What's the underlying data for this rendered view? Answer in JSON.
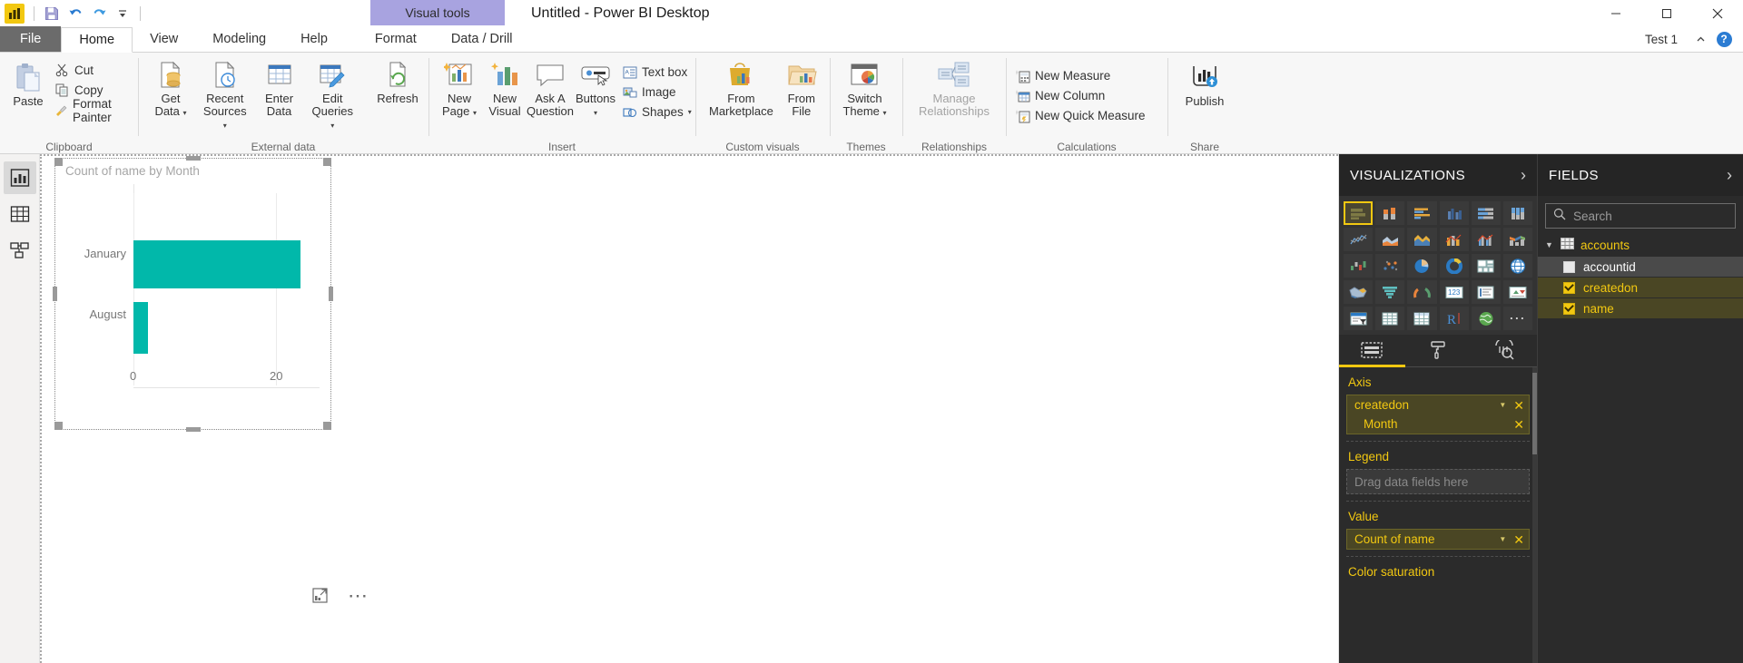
{
  "titlebar": {
    "app_logo": "powerbi-logo-icon",
    "quick_access": [
      {
        "name": "save-icon",
        "label": "Save"
      },
      {
        "name": "undo-icon",
        "label": "Undo"
      },
      {
        "name": "redo-icon",
        "label": "Redo"
      },
      {
        "name": "customize-qat-icon",
        "label": "Customize Quick Access Toolbar"
      }
    ],
    "contextual_tab_group": "Visual tools",
    "window_title": "Untitled - Power BI Desktop",
    "window_controls": [
      "minimize",
      "maximize",
      "close"
    ]
  },
  "tabs": {
    "file": "File",
    "items": [
      {
        "label": "Home",
        "active": true
      },
      {
        "label": "View",
        "active": false
      },
      {
        "label": "Modeling",
        "active": false
      },
      {
        "label": "Help",
        "active": false
      }
    ],
    "contextual": [
      {
        "label": "Format"
      },
      {
        "label": "Data / Drill"
      }
    ],
    "user": "Test 1",
    "collapse_ribbon": "chevron-up-icon",
    "help": "?"
  },
  "ribbon": {
    "groups": [
      {
        "label": "Clipboard",
        "big": [
          {
            "name": "paste-button",
            "label": "Paste"
          }
        ],
        "small": [
          {
            "name": "cut-button",
            "label": "Cut",
            "icon": "scissors-icon"
          },
          {
            "name": "copy-button",
            "label": "Copy",
            "icon": "copy-icon"
          },
          {
            "name": "format-painter-button",
            "label": "Format Painter",
            "icon": "paintbrush-icon"
          }
        ]
      },
      {
        "label": "External data",
        "big": [
          {
            "name": "get-data-button",
            "label": "Get\nData",
            "dropdown": true
          },
          {
            "name": "recent-sources-button",
            "label": "Recent\nSources",
            "dropdown": true
          },
          {
            "name": "enter-data-button",
            "label": "Enter\nData",
            "dropdown": false
          },
          {
            "name": "edit-queries-button",
            "label": "Edit\nQueries",
            "dropdown": true
          },
          {
            "name": "refresh-button",
            "label": "Refresh",
            "dropdown": false
          }
        ]
      },
      {
        "label": "Insert",
        "big": [
          {
            "name": "new-page-button",
            "label": "New\nPage",
            "dropdown": true
          },
          {
            "name": "new-visual-button",
            "label": "New\nVisual",
            "dropdown": false
          },
          {
            "name": "ask-a-question-button",
            "label": "Ask A\nQuestion",
            "dropdown": false
          },
          {
            "name": "buttons-button",
            "label": "Buttons",
            "dropdown": true
          }
        ],
        "small": [
          {
            "name": "text-box-button",
            "label": "Text box",
            "icon": "text-box-icon"
          },
          {
            "name": "image-button",
            "label": "Image",
            "icon": "image-icon"
          },
          {
            "name": "shapes-button",
            "label": "Shapes",
            "icon": "shapes-icon",
            "dropdown": true
          }
        ]
      },
      {
        "label": "Custom visuals",
        "big": [
          {
            "name": "from-marketplace-button",
            "label": "From\nMarketplace",
            "dropdown": false
          },
          {
            "name": "from-file-button",
            "label": "From\nFile",
            "dropdown": false
          }
        ]
      },
      {
        "label": "Themes",
        "big": [
          {
            "name": "switch-theme-button",
            "label": "Switch\nTheme",
            "dropdown": true
          }
        ]
      },
      {
        "label": "Relationships",
        "big": [
          {
            "name": "manage-relationships-button",
            "label": "Manage\nRelationships",
            "disabled": true
          }
        ]
      },
      {
        "label": "Calculations",
        "small": [
          {
            "name": "new-measure-button",
            "label": "New Measure",
            "icon": "new-measure-icon"
          },
          {
            "name": "new-column-button",
            "label": "New Column",
            "icon": "new-column-icon"
          },
          {
            "name": "new-quick-measure-button",
            "label": "New Quick Measure",
            "icon": "new-quick-measure-icon"
          }
        ]
      },
      {
        "label": "Share",
        "big": [
          {
            "name": "publish-button",
            "label": "Publish"
          }
        ]
      }
    ]
  },
  "leftnav": [
    {
      "name": "report-view-icon",
      "label": "Report",
      "active": true
    },
    {
      "name": "data-view-icon",
      "label": "Data",
      "active": false
    },
    {
      "name": "model-view-icon",
      "label": "Model",
      "active": false
    }
  ],
  "visual": {
    "title": "Count of name by Month",
    "footer_buttons": [
      {
        "name": "focus-mode-icon",
        "label": "Focus mode"
      },
      {
        "name": "more-options-icon",
        "label": "More options"
      }
    ]
  },
  "chart_data": {
    "type": "bar",
    "orientation": "horizontal",
    "title": "Count of name by Month",
    "categories": [
      "January",
      "August"
    ],
    "values": [
      22,
      2
    ],
    "series": [
      {
        "name": "Count of name",
        "values": [
          22,
          2
        ]
      }
    ],
    "xlabel": "",
    "ylabel": "",
    "xticks": [
      "0",
      "20"
    ],
    "xtick_values": [
      0,
      20
    ],
    "xlim": [
      0,
      24
    ],
    "grid": true,
    "legend": "none",
    "bar_color": "#01b8aa"
  },
  "visualizations": {
    "header": "VISUALIZATIONS",
    "expand_icon": "chevron-right-icon",
    "gallery": [
      {
        "name": "stacked-bar-chart-icon",
        "selected": true
      },
      {
        "name": "stacked-column-chart-icon",
        "selected": false
      },
      {
        "name": "clustered-bar-chart-icon",
        "selected": false
      },
      {
        "name": "clustered-column-chart-icon",
        "selected": false
      },
      {
        "name": "100-stacked-bar-chart-icon",
        "selected": false
      },
      {
        "name": "100-stacked-column-chart-icon",
        "selected": false
      },
      {
        "name": "line-chart-icon",
        "selected": false
      },
      {
        "name": "area-chart-icon",
        "selected": false
      },
      {
        "name": "stacked-area-chart-icon",
        "selected": false
      },
      {
        "name": "line-stacked-column-chart-icon",
        "selected": false
      },
      {
        "name": "line-clustered-column-chart-icon",
        "selected": false
      },
      {
        "name": "ribbon-chart-icon",
        "selected": false
      },
      {
        "name": "waterfall-chart-icon",
        "selected": false
      },
      {
        "name": "scatter-chart-icon",
        "selected": false
      },
      {
        "name": "pie-chart-icon",
        "selected": false
      },
      {
        "name": "donut-chart-icon",
        "selected": false
      },
      {
        "name": "treemap-icon",
        "selected": false
      },
      {
        "name": "map-icon",
        "selected": false
      },
      {
        "name": "filled-map-icon",
        "selected": false
      },
      {
        "name": "funnel-icon",
        "selected": false
      },
      {
        "name": "gauge-icon",
        "selected": false
      },
      {
        "name": "card-icon",
        "selected": false
      },
      {
        "name": "multi-row-card-icon",
        "selected": false
      },
      {
        "name": "kpi-icon",
        "selected": false
      },
      {
        "name": "slicer-icon",
        "selected": false
      },
      {
        "name": "table-icon",
        "selected": false
      },
      {
        "name": "matrix-icon",
        "selected": false
      },
      {
        "name": "r-script-visual-icon",
        "selected": false
      },
      {
        "name": "arcgis-map-icon",
        "selected": false
      },
      {
        "name": "more-visuals-icon",
        "selected": false
      }
    ],
    "subtabs": [
      {
        "name": "fields-tab",
        "icon": "fields-pane-icon",
        "active": true
      },
      {
        "name": "format-tab",
        "icon": "paint-roller-icon",
        "active": false
      },
      {
        "name": "analytics-tab",
        "icon": "magnifier-chart-icon",
        "active": false
      }
    ],
    "wells": [
      {
        "label": "Axis",
        "chips": [
          {
            "text": "createdon",
            "has_caret": true,
            "has_remove": true,
            "sub": {
              "text": "Month",
              "has_remove": true
            }
          }
        ],
        "placeholder": null
      },
      {
        "label": "Legend",
        "chips": [],
        "placeholder": "Drag data fields here"
      },
      {
        "label": "Value",
        "chips": [
          {
            "text": "Count of name",
            "has_caret": true,
            "has_remove": true
          }
        ],
        "placeholder": null
      },
      {
        "label": "Color saturation",
        "chips": [],
        "placeholder": null
      }
    ]
  },
  "fields": {
    "header": "FIELDS",
    "expand_icon": "chevron-right-icon",
    "search_placeholder": "Search",
    "search_value": "",
    "search_icon": "search-icon",
    "tables": [
      {
        "name": "accounts",
        "expanded": true,
        "icon": "table-grid-icon",
        "columns": [
          {
            "label": "accountid",
            "checked": false
          },
          {
            "label": "createdon",
            "checked": true
          },
          {
            "label": "name",
            "checked": true
          }
        ]
      }
    ]
  },
  "colors": {
    "accent_yellow": "#f2c811",
    "teal_bar": "#01b8aa",
    "contextual_purple": "#a8a3e0",
    "pane_dark": "#2b2b2b"
  }
}
